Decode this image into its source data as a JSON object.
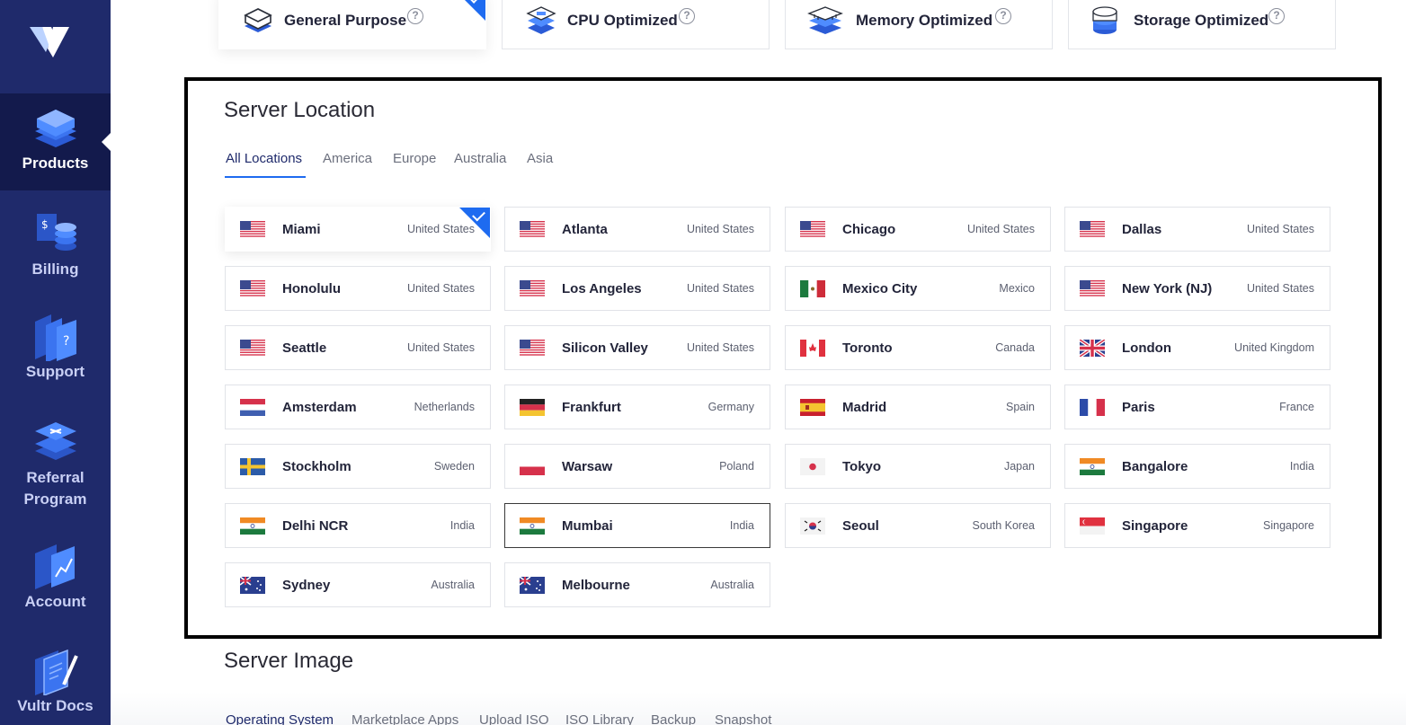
{
  "sidebar": {
    "items": [
      {
        "label": "Products",
        "icon": "stack-icon",
        "active": true
      },
      {
        "label": "Billing",
        "icon": "billing-icon"
      },
      {
        "label": "Support",
        "icon": "support-icon"
      },
      {
        "label": "Referral Program",
        "icon": "referral-icon"
      },
      {
        "label": "Account",
        "icon": "account-icon"
      },
      {
        "label": "Vultr Docs",
        "icon": "docs-icon"
      }
    ]
  },
  "plans": [
    {
      "label": "General Purpose",
      "selected": true
    },
    {
      "label": "CPU Optimized"
    },
    {
      "label": "Memory Optimized"
    },
    {
      "label": "Storage Optimized"
    }
  ],
  "server_location": {
    "title": "Server Location",
    "tabs": [
      "All Locations",
      "America",
      "Europe",
      "Australia",
      "Asia"
    ],
    "active_tab": "All Locations",
    "locations": [
      {
        "city": "Miami",
        "country": "United States",
        "flag": "us",
        "selected": true
      },
      {
        "city": "Atlanta",
        "country": "United States",
        "flag": "us"
      },
      {
        "city": "Chicago",
        "country": "United States",
        "flag": "us"
      },
      {
        "city": "Dallas",
        "country": "United States",
        "flag": "us"
      },
      {
        "city": "Honolulu",
        "country": "United States",
        "flag": "us"
      },
      {
        "city": "Los Angeles",
        "country": "United States",
        "flag": "us"
      },
      {
        "city": "Mexico City",
        "country": "Mexico",
        "flag": "mx"
      },
      {
        "city": "New York (NJ)",
        "country": "United States",
        "flag": "us"
      },
      {
        "city": "Seattle",
        "country": "United States",
        "flag": "us"
      },
      {
        "city": "Silicon Valley",
        "country": "United States",
        "flag": "us"
      },
      {
        "city": "Toronto",
        "country": "Canada",
        "flag": "ca"
      },
      {
        "city": "London",
        "country": "United Kingdom",
        "flag": "gb"
      },
      {
        "city": "Amsterdam",
        "country": "Netherlands",
        "flag": "nl"
      },
      {
        "city": "Frankfurt",
        "country": "Germany",
        "flag": "de"
      },
      {
        "city": "Madrid",
        "country": "Spain",
        "flag": "es"
      },
      {
        "city": "Paris",
        "country": "France",
        "flag": "fr"
      },
      {
        "city": "Stockholm",
        "country": "Sweden",
        "flag": "se"
      },
      {
        "city": "Warsaw",
        "country": "Poland",
        "flag": "pl"
      },
      {
        "city": "Tokyo",
        "country": "Japan",
        "flag": "jp"
      },
      {
        "city": "Bangalore",
        "country": "India",
        "flag": "in"
      },
      {
        "city": "Delhi NCR",
        "country": "India",
        "flag": "in"
      },
      {
        "city": "Mumbai",
        "country": "India",
        "flag": "in",
        "focused": true
      },
      {
        "city": "Seoul",
        "country": "South Korea",
        "flag": "kr"
      },
      {
        "city": "Singapore",
        "country": "Singapore",
        "flag": "sg"
      },
      {
        "city": "Sydney",
        "country": "Australia",
        "flag": "au"
      },
      {
        "city": "Melbourne",
        "country": "Australia",
        "flag": "au"
      }
    ]
  },
  "server_image": {
    "title": "Server Image",
    "tabs": [
      "Operating System",
      "Marketplace Apps",
      "Upload ISO",
      "ISO Library",
      "Backup",
      "Snapshot"
    ]
  },
  "colors": {
    "sidebar": "#1f2a6b",
    "sidebar_active": "#131a4c",
    "accent": "#1e6bf0"
  }
}
